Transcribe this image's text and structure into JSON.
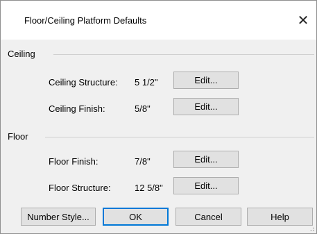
{
  "dialog": {
    "title": "Floor/Ceiling Platform Defaults",
    "close_glyph": "✕"
  },
  "ceiling": {
    "section_label": "Ceiling",
    "structure_label": "Ceiling Structure:",
    "structure_value": "5 1/2\"",
    "structure_edit": "Edit...",
    "finish_label": "Ceiling Finish:",
    "finish_value": "5/8\"",
    "finish_edit": "Edit..."
  },
  "floor": {
    "section_label": "Floor",
    "finish_label": "Floor Finish:",
    "finish_value": "7/8\"",
    "finish_edit": "Edit...",
    "structure_label": "Floor Structure:",
    "structure_value": "12 5/8\"",
    "structure_edit": "Edit..."
  },
  "buttons": {
    "number_style": "Number Style...",
    "ok": "OK",
    "cancel": "Cancel",
    "help": "Help"
  },
  "colors": {
    "default_button_border": "#0078d7",
    "dialog_background": "#f0f0f0"
  }
}
